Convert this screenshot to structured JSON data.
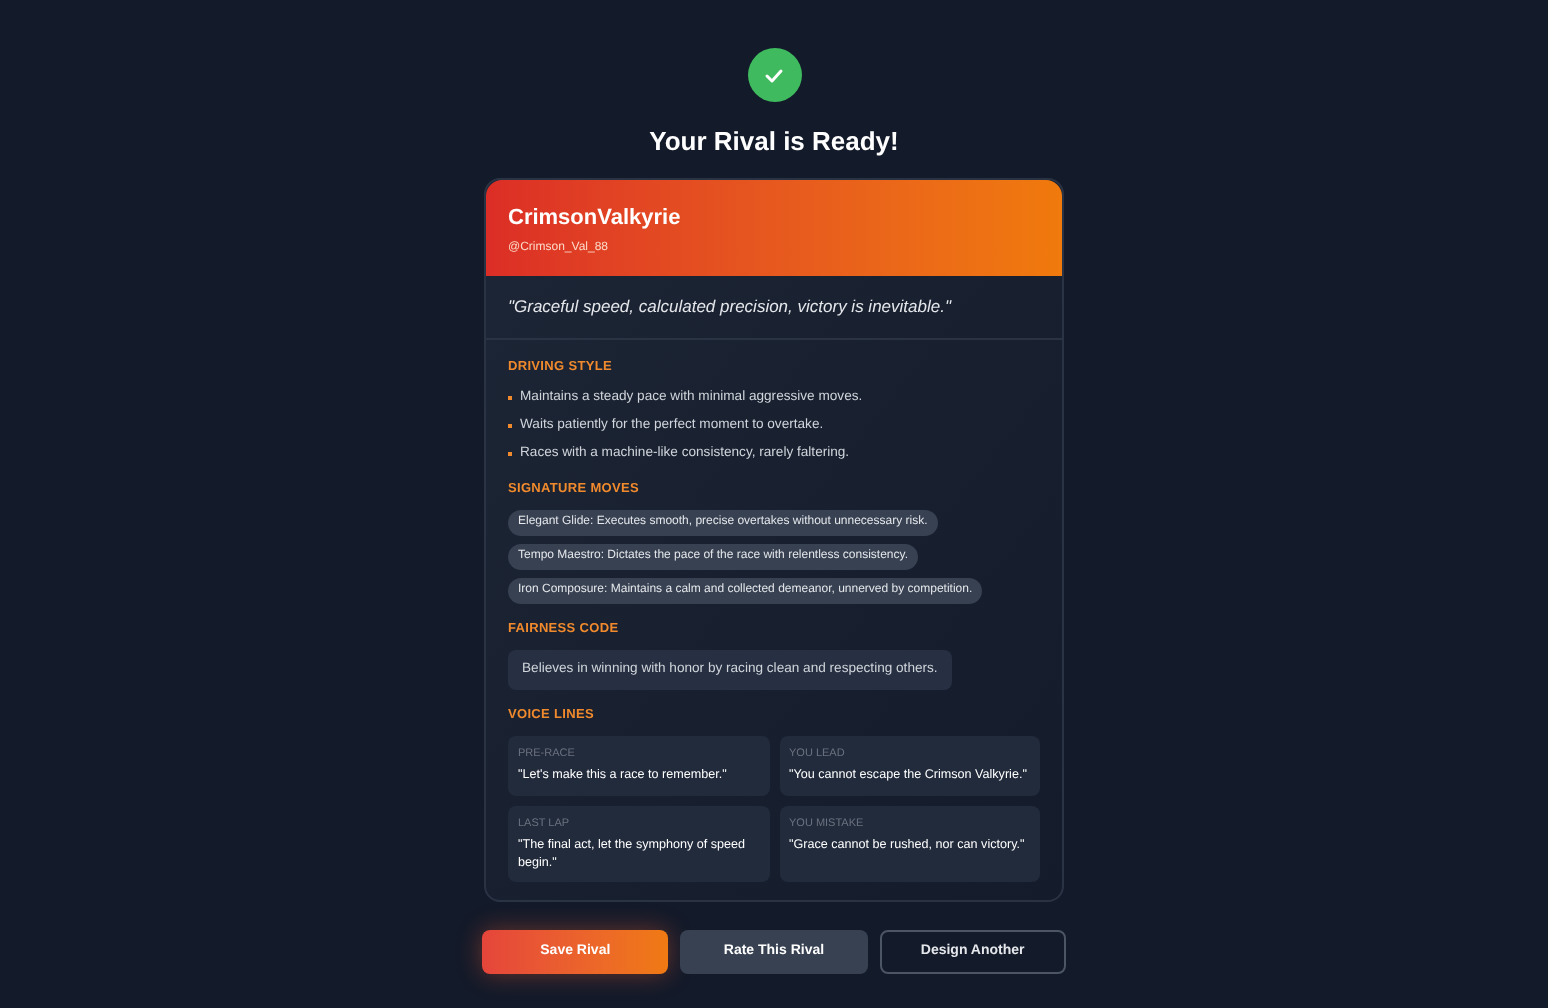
{
  "heading": "Your Rival is Ready!",
  "rival": {
    "name": "CrimsonValkyrie",
    "handle": "@Crimson_Val_88",
    "quote": "\"Graceful speed, calculated precision, victory is inevitable.\""
  },
  "driving_style": {
    "title": "DRIVING STYLE",
    "items": [
      "Maintains a steady pace with minimal aggressive moves.",
      "Waits patiently for the perfect moment to overtake.",
      "Races with a machine-like consistency, rarely faltering."
    ]
  },
  "signature_moves": {
    "title": "SIGNATURE MOVES",
    "items": [
      "Elegant Glide: Executes smooth, precise overtakes without unnecessary risk.",
      "Tempo Maestro: Dictates the pace of the race with relentless consistency.",
      "Iron Composure: Maintains a calm and collected demeanor, unnerved by competition."
    ]
  },
  "fairness_code": {
    "title": "FAIRNESS CODE",
    "text": "Believes in winning with honor by racing clean and respecting others."
  },
  "voice_lines": {
    "title": "VOICE LINES",
    "items": [
      {
        "label": "PRE-RACE",
        "line": "\"Let's make this a race to remember.\""
      },
      {
        "label": "YOU LEAD",
        "line": "\"You cannot escape the Crimson Valkyrie.\""
      },
      {
        "label": "LAST LAP",
        "line": "\"The final act, let the symphony of speed begin.\""
      },
      {
        "label": "YOU MISTAKE",
        "line": "\"Grace cannot be rushed, nor can victory.\""
      }
    ]
  },
  "buttons": [
    {
      "label": "Save Rival",
      "kind": "primary"
    },
    {
      "label": "Rate This Rival",
      "kind": "secondary"
    },
    {
      "label": "Design Another",
      "kind": "outline"
    }
  ]
}
